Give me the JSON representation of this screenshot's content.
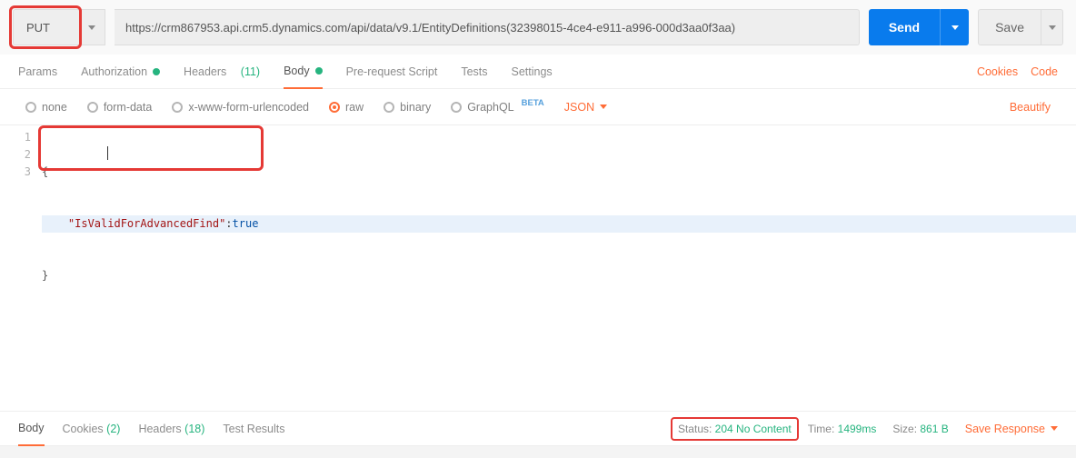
{
  "request": {
    "method": "PUT",
    "url": "https://crm867953.api.crm5.dynamics.com/api/data/v9.1/EntityDefinitions(32398015-4ce4-e911-a996-000d3aa0f3aa)",
    "send_label": "Send",
    "save_label": "Save"
  },
  "tabs": {
    "params": "Params",
    "authorization": "Authorization",
    "headers": "Headers",
    "headers_count": "(11)",
    "body": "Body",
    "prereq": "Pre-request Script",
    "tests": "Tests",
    "settings": "Settings",
    "cookies": "Cookies",
    "code": "Code"
  },
  "body_types": {
    "none": "none",
    "formdata": "form-data",
    "urlencoded": "x-www-form-urlencoded",
    "raw": "raw",
    "binary": "binary",
    "graphql": "GraphQL",
    "graphql_beta": "BETA",
    "json": "JSON",
    "beautify": "Beautify"
  },
  "editor": {
    "lines": [
      "1",
      "2",
      "3"
    ],
    "l1": "{",
    "l2_key": "\"IsValidForAdvancedFind\"",
    "l2_colon": ":",
    "l2_val": "true",
    "l3": "}"
  },
  "response": {
    "body": "Body",
    "cookies": "Cookies",
    "cookies_count": "(2)",
    "headers": "Headers",
    "headers_count": "(18)",
    "testresults": "Test Results",
    "status_label": "Status:",
    "status_value": "204 No Content",
    "time_label": "Time:",
    "time_value": "1499ms",
    "size_label": "Size:",
    "size_value": "861 B",
    "save_response": "Save Response"
  }
}
